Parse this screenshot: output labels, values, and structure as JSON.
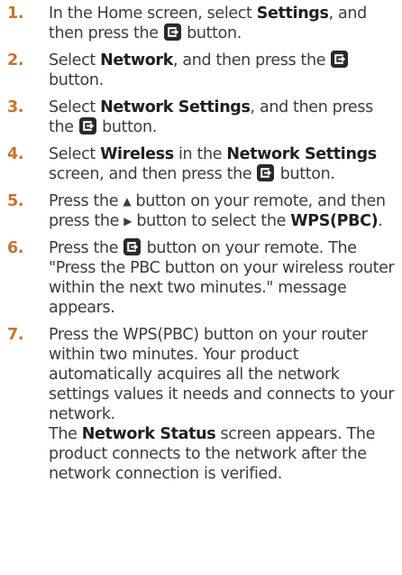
{
  "steps": [
    {
      "num": "1.",
      "t1": "In the Home screen, select ",
      "b1": "Settings",
      "t2": ", and then press the ",
      "icon": "enter-icon",
      "t3": " button."
    },
    {
      "num": "2.",
      "t1": "Select ",
      "b1": "Network",
      "t2": ", and then press the ",
      "icon": "enter-icon",
      "t3": " button."
    },
    {
      "num": "3.",
      "t1": "Select ",
      "b1": "Network Settings",
      "t2": ", and then press the ",
      "icon": "enter-icon",
      "t3": " button."
    },
    {
      "num": "4.",
      "t1": "Select ",
      "b1": "Wireless",
      "t2": " in the ",
      "b2": "Network Settings",
      "t3": " screen, and then press the ",
      "icon": "enter-icon",
      "t4": " button."
    },
    {
      "num": "5.",
      "t1": "Press the ",
      "up_icon": "▲",
      "t2": " button on your remote, and then press the ",
      "right_icon": "▶",
      "t3": " button to select the ",
      "b1": "WPS(PBC)",
      "t4": "."
    },
    {
      "num": "6.",
      "t1": "Press the ",
      "icon": "enter-icon",
      "t2": " button on your remote. The \"Press the PBC button on your wireless router within the next two minutes.\" message appears."
    },
    {
      "num": "7.",
      "t1": "Press the WPS(PBC) button on your router within two minutes. Your product automatically acquires all the network settings values it needs and connects to your network.",
      "t2": "The ",
      "b1": "Network Status",
      "t3": " screen appears. The product connects to the network after the network connection is verified."
    }
  ],
  "colors": {
    "step_number": "#c8732c",
    "body_text": "#3c3c3c",
    "bold_text": "#202020",
    "icon_bg": "#2a2a2a"
  }
}
